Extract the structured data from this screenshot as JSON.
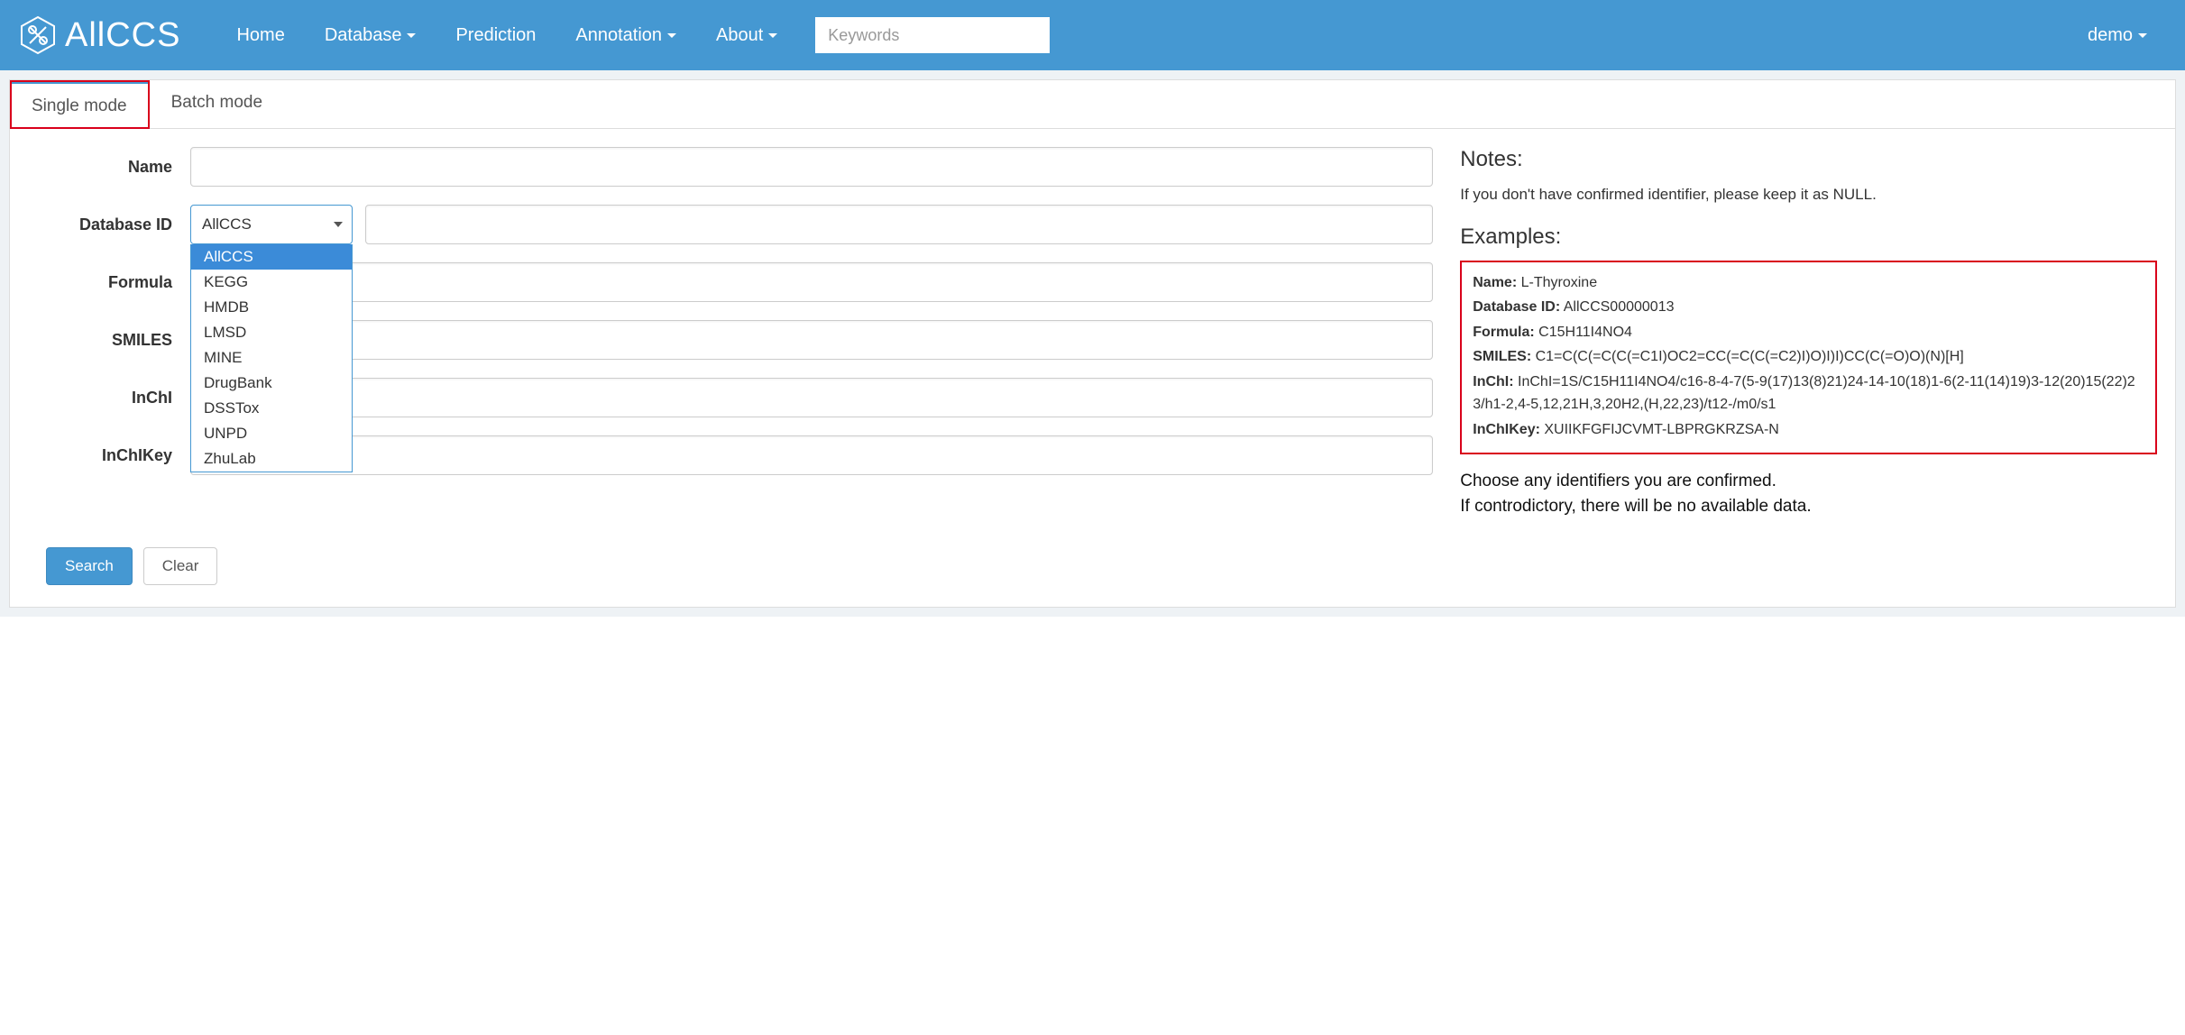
{
  "navbar": {
    "brand": "AllCCS",
    "items": [
      {
        "label": "Home",
        "dropdown": false
      },
      {
        "label": "Database",
        "dropdown": true
      },
      {
        "label": "Prediction",
        "dropdown": false
      },
      {
        "label": "Annotation",
        "dropdown": true
      },
      {
        "label": "About",
        "dropdown": true
      }
    ],
    "search_placeholder": "Keywords",
    "user": "demo"
  },
  "tabs": {
    "single": "Single mode",
    "batch": "Batch mode"
  },
  "form": {
    "labels": {
      "name": "Name",
      "database_id": "Database ID",
      "formula": "Formula",
      "smiles": "SMILES",
      "inchi": "InChI",
      "inchikey": "InChIKey"
    },
    "db_selected": "AllCCS",
    "db_options": [
      "AllCCS",
      "KEGG",
      "HMDB",
      "LMSD",
      "MINE",
      "DrugBank",
      "DSSTox",
      "UNPD",
      "ZhuLab"
    ],
    "buttons": {
      "search": "Search",
      "clear": "Clear"
    }
  },
  "notes": {
    "heading": "Notes:",
    "text": "If you don't have confirmed identifier, please keep it as NULL.",
    "examples_heading": "Examples:",
    "example": {
      "name_label": "Name:",
      "name_value": "L-Thyroxine",
      "dbid_label": "Database ID:",
      "dbid_value": "AllCCS00000013",
      "formula_label": "Formula:",
      "formula_value": "C15H11I4NO4",
      "smiles_label": "SMILES:",
      "smiles_value": "C1=C(C(=C(C(=C1I)OC2=CC(=C(C(=C2)I)O)I)I)CC(C(=O)O)(N)[H]",
      "inchi_label": "InChI:",
      "inchi_value": "InChI=1S/C15H11I4NO4/c16-8-4-7(5-9(17)13(8)21)24-14-10(18)1-6(2-11(14)19)3-12(20)15(22)23/h1-2,4-5,12,21H,3,20H2,(H,22,23)/t12-/m0/s1",
      "inchikey_label": "InChIKey:",
      "inchikey_value": "XUIIKFGFIJCVMT-LBPRGKRZSA-N"
    },
    "footer_line1": "Choose any identifiers you are confirmed.",
    "footer_line2": "If controdictory, there will be no available data."
  }
}
